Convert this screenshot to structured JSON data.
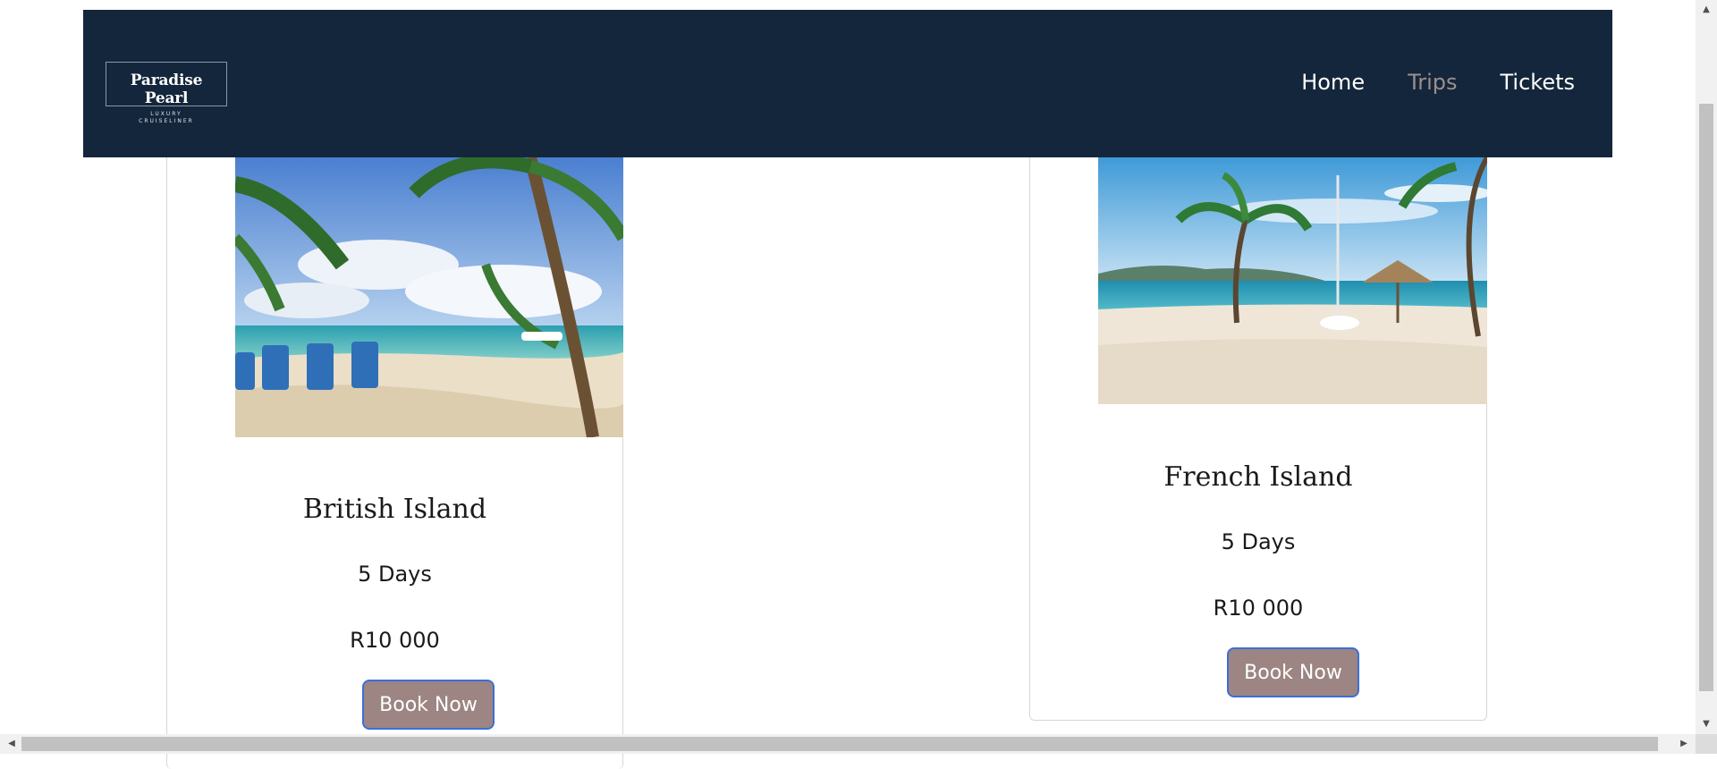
{
  "navbar": {
    "logo": {
      "title": "Paradise Pearl",
      "subtitle": "LUXURY\nCRUISELINER"
    },
    "links": [
      {
        "label": "Home",
        "active": false
      },
      {
        "label": "Trips",
        "active": true
      },
      {
        "label": "Tickets",
        "active": false
      }
    ]
  },
  "trips": [
    {
      "title": "British Island",
      "duration": "5 Days",
      "price": "R10 000",
      "button": "Book Now"
    },
    {
      "title": "French Island",
      "duration": "5 Days",
      "price": "R10 000",
      "button": "Book Now"
    }
  ],
  "colors": {
    "navbar": "#14263b",
    "nav_active": "#9c8f8c",
    "button_bg": "#9c8582",
    "button_border": "#3b6fd6"
  },
  "icons": {
    "scroll_up": "▲",
    "scroll_down": "▼",
    "scroll_left": "◀",
    "scroll_right": "▶"
  }
}
